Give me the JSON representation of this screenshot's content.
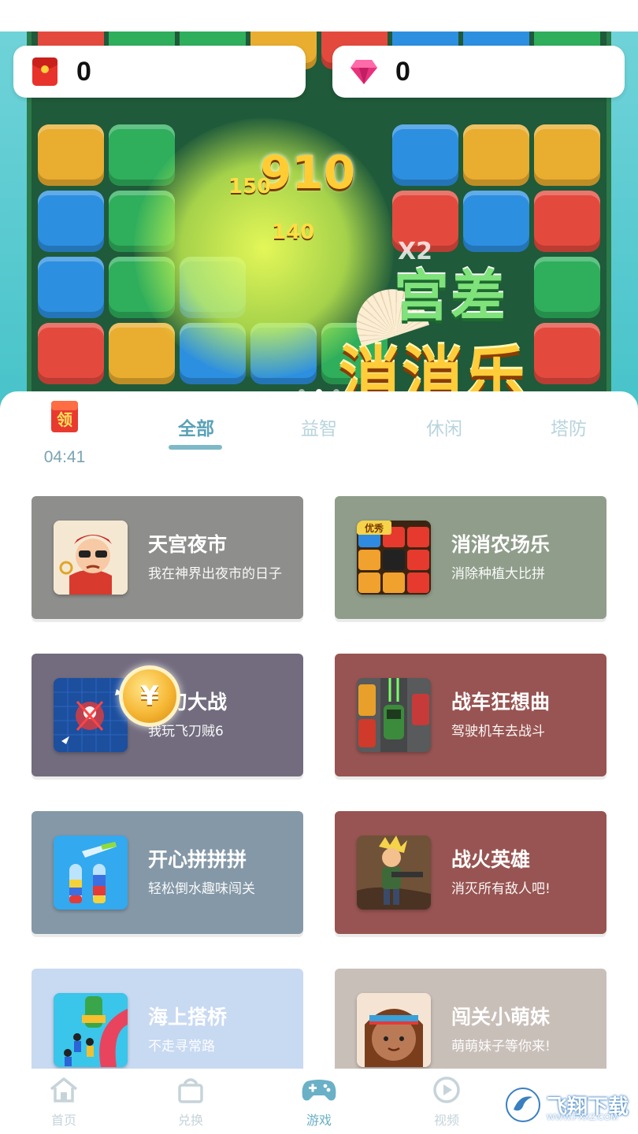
{
  "wallet": {
    "redpacket_value": "0",
    "gem_value": "0"
  },
  "banner": {
    "score_big": "910",
    "score_1": "150",
    "score_2": "140",
    "multiplier": "X2",
    "logo_line1": "宫差",
    "logo_line2": "消消乐"
  },
  "reward": {
    "icon_text": "领",
    "countdown": "04:41"
  },
  "tabs": [
    {
      "label": "全部"
    },
    {
      "label": "益智"
    },
    {
      "label": "休闲"
    },
    {
      "label": "塔防"
    }
  ],
  "games": [
    {
      "title": "天宫夜市",
      "subtitle": "我在神界出夜市的日子",
      "color": "#8e8e8c"
    },
    {
      "title": "消消农场乐",
      "subtitle": "消除种植大比拼",
      "color": "#8f9d8a",
      "thumb_badge": "优秀"
    },
    {
      "title": "飞刀大战",
      "subtitle": "我玩飞刀贼6",
      "color": "#726c7e"
    },
    {
      "title": "战车狂想曲",
      "subtitle": "驾驶机车去战斗",
      "color": "#985452"
    },
    {
      "title": "开心拼拼拼",
      "subtitle": "轻松倒水趣味闯关",
      "color": "#8598a7"
    },
    {
      "title": "战火英雄",
      "subtitle": "消灭所有敌人吧!",
      "color": "#985452"
    },
    {
      "title": "海上搭桥",
      "subtitle": "不走寻常路",
      "color": "#c8d9f2"
    },
    {
      "title": "闯关小萌妹",
      "subtitle": "萌萌妹子等你来!",
      "color": "#c9bfb9"
    }
  ],
  "coin_symbol": "¥",
  "nav": [
    {
      "label": "首页",
      "icon": "home-icon"
    },
    {
      "label": "兑换",
      "icon": "bag-icon"
    },
    {
      "label": "游戏",
      "icon": "gamepad-icon"
    },
    {
      "label": "视频",
      "icon": "play-icon"
    }
  ],
  "watermark": {
    "text": "飞翔下载",
    "url": "WWW.FXXZ.COM"
  }
}
